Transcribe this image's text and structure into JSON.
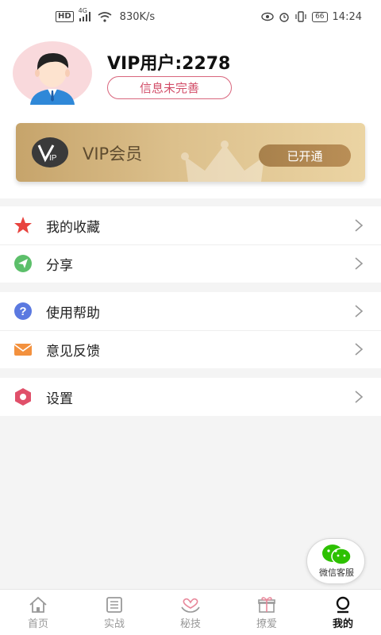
{
  "status_bar": {
    "network_badge": "HD",
    "signal_text": "4G",
    "speed": "830K/s",
    "battery": "66",
    "time": "14:24"
  },
  "profile": {
    "username": "VIP用户:2278",
    "incomplete_button": "信息未完善"
  },
  "vip": {
    "logo_text": "VIP",
    "title": "VIP会员",
    "status_button": "已开通",
    "colors": {
      "card_start": "#c6a46b",
      "card_end": "#ebd4a3",
      "button": "#a8814c"
    }
  },
  "menu": {
    "favorites": "我的收藏",
    "share": "分享",
    "help": "使用帮助",
    "feedback": "意见反馈",
    "settings": "设置"
  },
  "floating": {
    "wechat_label": "微信客服"
  },
  "tabs": [
    {
      "label": "首页",
      "icon": "home-icon"
    },
    {
      "label": "实战",
      "icon": "list-icon"
    },
    {
      "label": "秘技",
      "icon": "heart-hands-icon"
    },
    {
      "label": "撩爱",
      "icon": "gift-icon"
    },
    {
      "label": "我的",
      "icon": "profile-icon",
      "active": true
    }
  ]
}
